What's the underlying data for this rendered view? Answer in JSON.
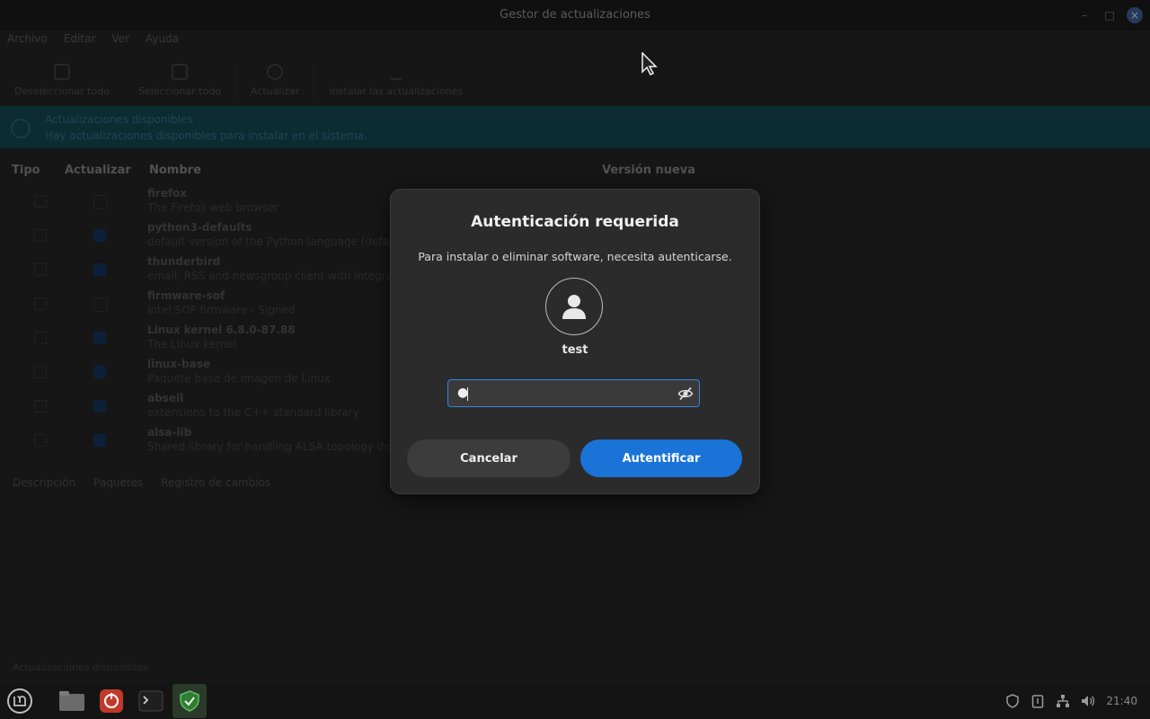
{
  "window": {
    "title": "Gestor de actualizaciones",
    "controls": [
      "–",
      "□",
      "×"
    ]
  },
  "menubar": [
    "Archivo",
    "Editar",
    "Ver",
    "Ayuda"
  ],
  "toolbar": [
    {
      "label": "Deseleccionar todo",
      "icon": "deselect-icon"
    },
    {
      "label": "Seleccionar todo",
      "icon": "select-all-icon"
    },
    {
      "label": "Actualizar",
      "icon": "refresh-icon"
    },
    {
      "label": "Instalar las actualizaciones",
      "icon": "download-icon"
    }
  ],
  "banner": {
    "line1": "Actualizaciones disponibles",
    "line2": "Hay actualizaciones disponibles para instalar en el sistema."
  },
  "columns": {
    "tipo": "Tipo",
    "actualizar": "Actualizar",
    "nombre": "Nombre",
    "version": "Versión nueva"
  },
  "packages": [
    {
      "name": "firefox",
      "desc": "The Firefox web browser",
      "checked": false
    },
    {
      "name": "python3-defaults",
      "desc": "default version of the Python language (defa",
      "checked": true
    },
    {
      "name": "thunderbird",
      "desc": "email, RSS and newsgroup client with integrat",
      "checked": true
    },
    {
      "name": "firmware-sof",
      "desc": "Intel SOF firmware - Signed",
      "checked": false
    },
    {
      "name": "Linux kernel 6.8.0-87.88",
      "desc": "The Linux kernel",
      "checked": true
    },
    {
      "name": "linux-base",
      "desc": "Paquete base de imagen de Linux",
      "checked": true
    },
    {
      "name": "abseil",
      "desc": "extensions to the C++ standard library",
      "checked": true
    },
    {
      "name": "alsa-lib",
      "desc": "Shared library for handling ALSA topology de",
      "checked": true
    }
  ],
  "tabs": [
    "Descripción",
    "Paquetes",
    "Registro de cambios"
  ],
  "status": "Actualizaciones disponibles",
  "dialog": {
    "title": "Autenticación requerida",
    "message": "Para instalar o eliminar software, necesita autenticarse.",
    "username": "test",
    "password_masked": "●",
    "cancel_label": "Cancelar",
    "auth_label": "Autentificar"
  },
  "taskbar": {
    "clock": "21:40",
    "apps": [
      "menu-icon",
      "files-icon",
      "software-icon",
      "terminal-icon",
      "update-manager-icon"
    ],
    "tray": [
      "shield-icon",
      "clipboard-icon",
      "network-icon",
      "volume-icon"
    ]
  },
  "colors": {
    "accent": "#1a73d6",
    "field_border": "#3584e4",
    "banner": "#15424f"
  }
}
